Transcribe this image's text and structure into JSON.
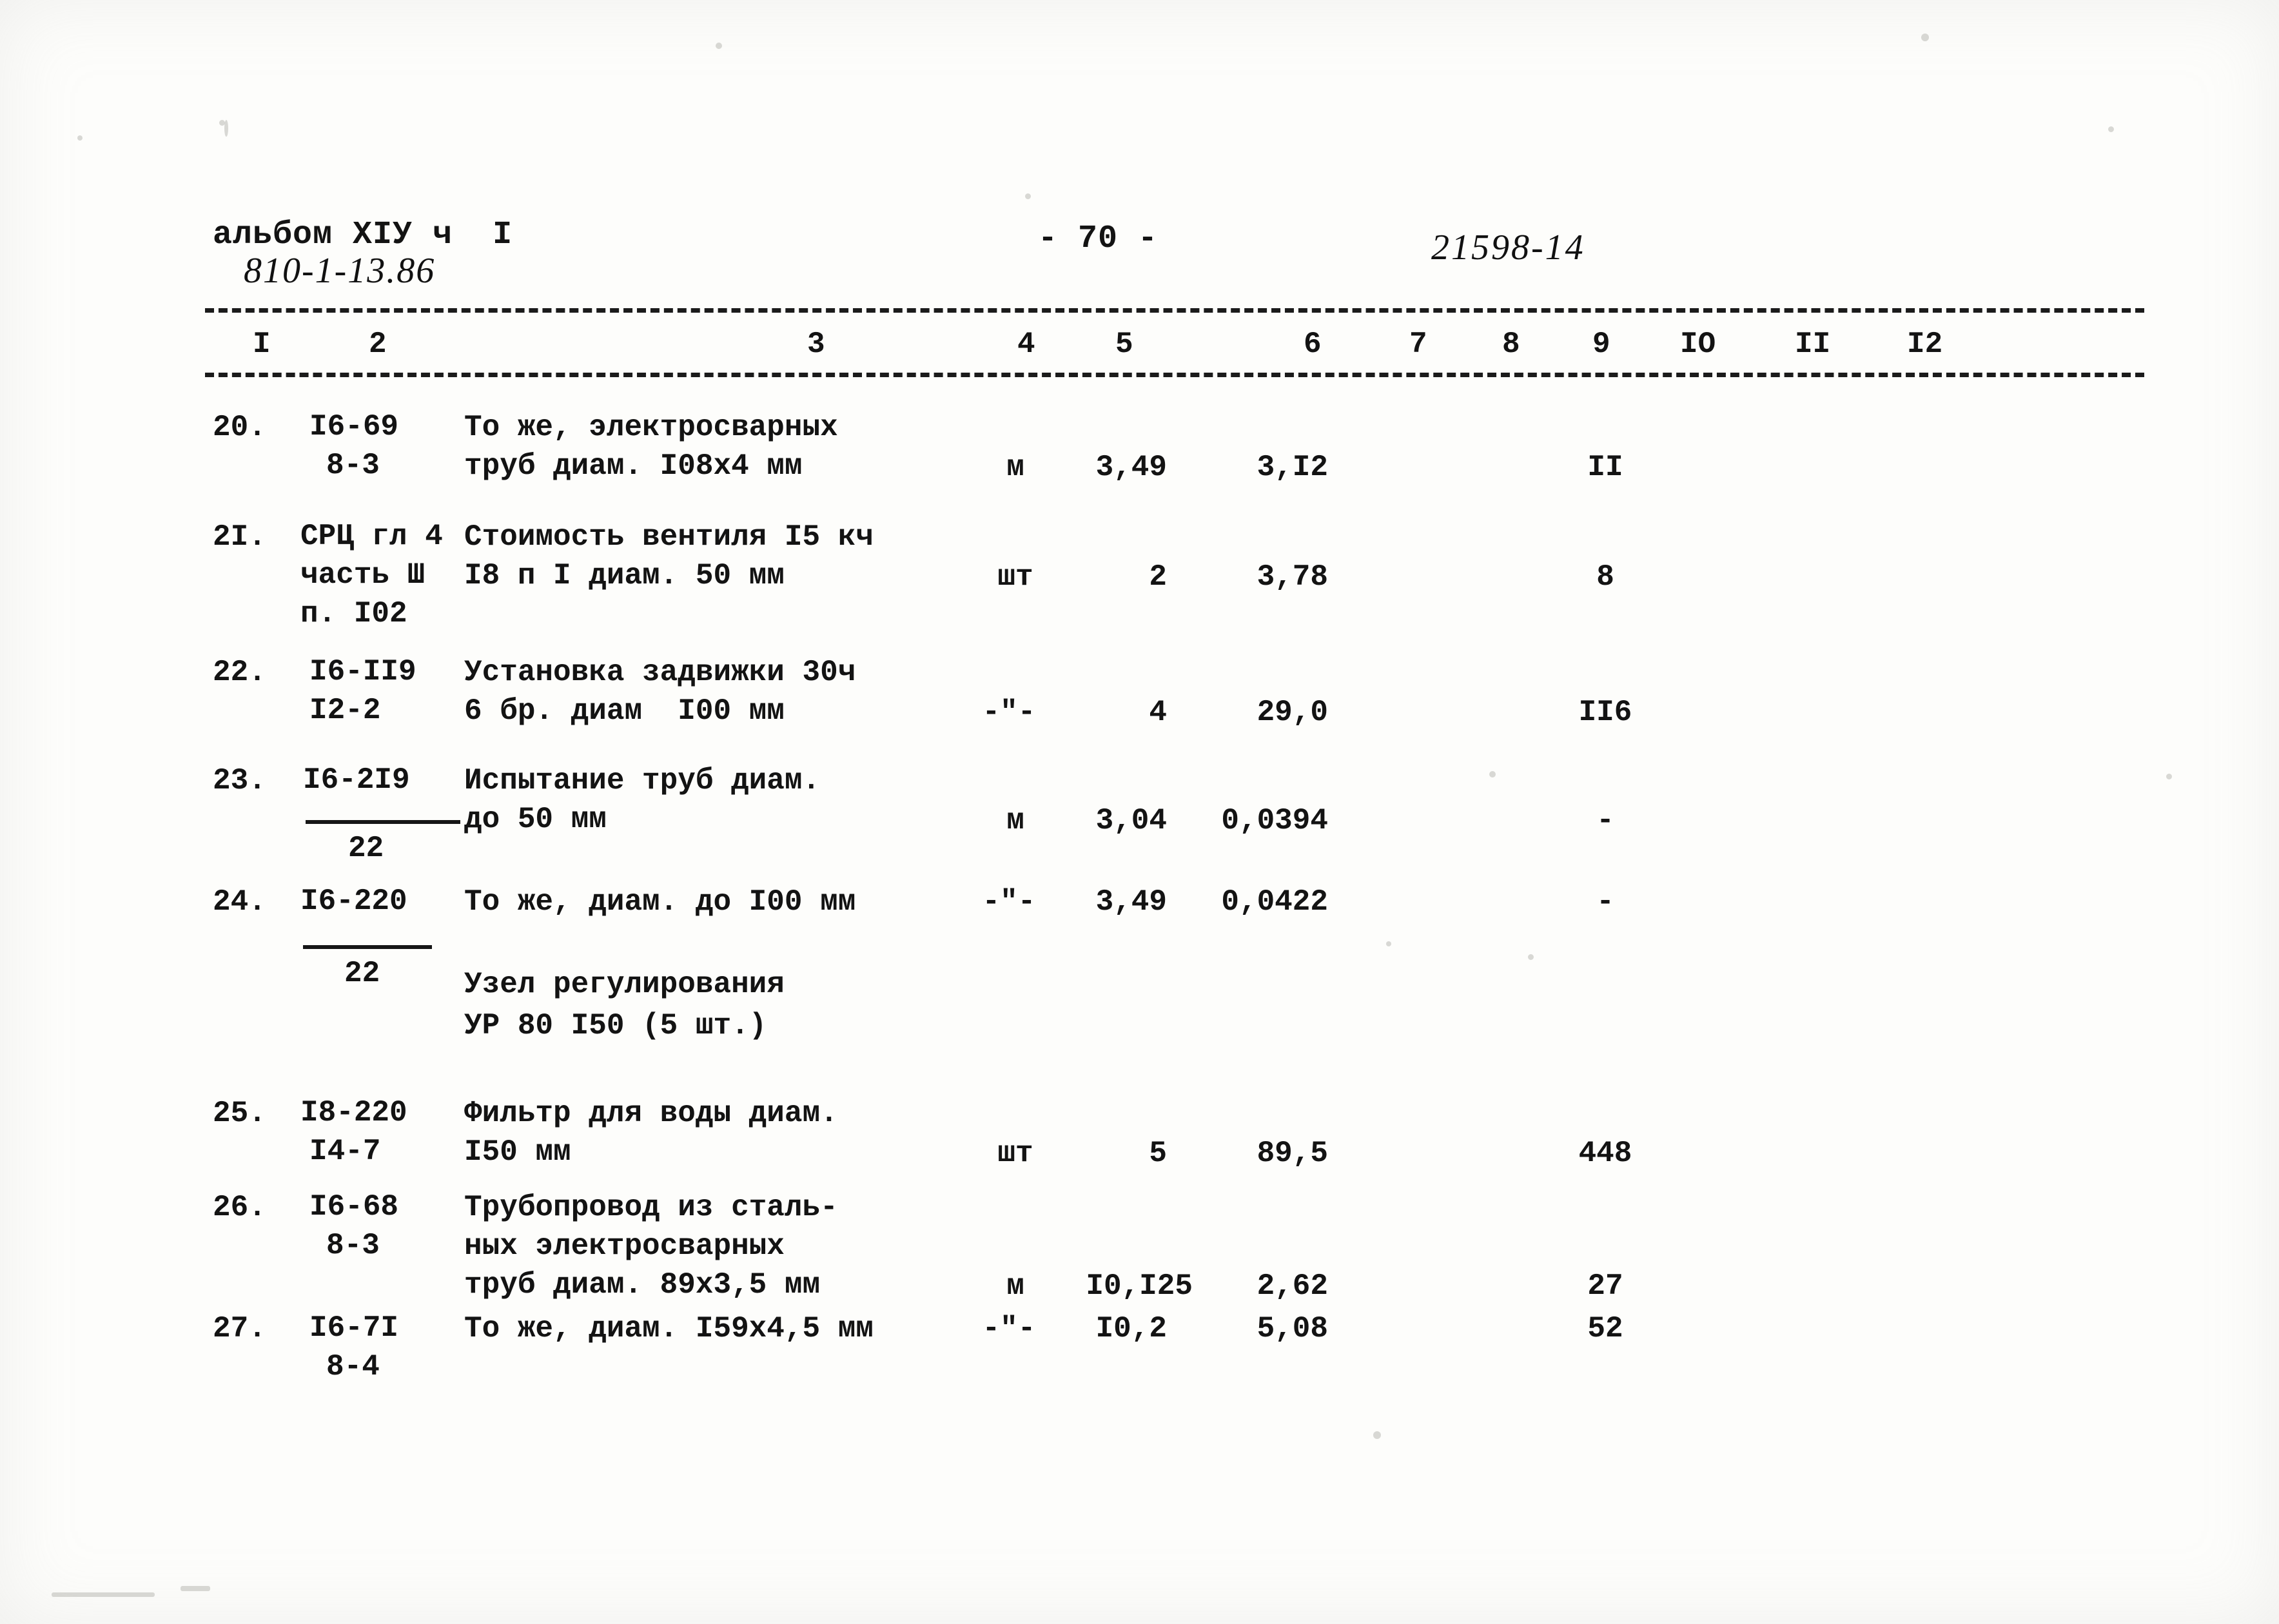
{
  "document": {
    "album_line": "альбом XIУ ч  I",
    "album_code_handwritten": "810-1-13.86",
    "page_number": "- 70 -",
    "doc_code_handwritten": "21598-14"
  },
  "table": {
    "column_numbers": [
      "I",
      "2",
      "3",
      "4",
      "5",
      "6",
      "7",
      "8",
      "9",
      "IO",
      "II",
      "I2"
    ],
    "rows": [
      {
        "no": "20.",
        "code_line1": "I6-69",
        "code_line2": "8-3",
        "desc_line1": "То же, электросварных",
        "desc_line2": "труб диам. I08х4 мм",
        "unit": "м",
        "qty": "3,49",
        "price": "3,I2",
        "total": "II"
      },
      {
        "no": "2I.",
        "code_line1": "СРЦ гл 4",
        "code_line2": "часть Ш",
        "code_line3": "п. I02",
        "desc_line1": "Стоимость вентиля I5 кч",
        "desc_line2": "I8 п I диам. 50 мм",
        "unit": "шт",
        "qty": "2",
        "price": "3,78",
        "total": "8"
      },
      {
        "no": "22.",
        "code_line1": "I6-II9",
        "code_line2": "I2-2",
        "desc_line1": "Установка задвижки 30ч",
        "desc_line2": "6 бр. диам  I00 мм",
        "unit": "-\"-",
        "qty": "4",
        "price": "29,0",
        "total": "II6"
      },
      {
        "no": "23.",
        "code_line1": "I6-2I9",
        "code_line2": "22",
        "code_fraction": true,
        "desc_line1": "Испытание труб диам.",
        "desc_line2": "до 50 мм",
        "unit": "м",
        "qty": "3,04",
        "price": "0,0394",
        "total": "-"
      },
      {
        "no": "24.",
        "code_line1": "I6-220",
        "code_line2": "22",
        "code_fraction": true,
        "desc_line1": "То же, диам. до I00 мм",
        "desc_line2": "",
        "unit": "-\"-",
        "qty": "3,49",
        "price": "0,0422",
        "total": "-"
      },
      {
        "no": "25.",
        "code_line1": "I8-220",
        "code_line2": "I4-7",
        "desc_line1": "Фильтр для воды диам.",
        "desc_line2": "I50 мм",
        "unit": "шт",
        "qty": "5",
        "price": "89,5",
        "total": "448"
      },
      {
        "no": "26.",
        "code_line1": "I6-68",
        "code_line2": "8-3",
        "desc_line1": "Трубопровод из сталь-",
        "desc_line2": "ных электросварных",
        "desc_line3": "труб диам. 89х3,5 мм",
        "unit": "м",
        "qty": "I0,I25",
        "price": "2,62",
        "total": "27"
      },
      {
        "no": "27.",
        "code_line1": "I6-7I",
        "code_line2": "8-4",
        "desc_line1": "То же, диам. I59х4,5 мм",
        "desc_line2": "",
        "unit": "-\"-",
        "qty": "I0,2",
        "price": "5,08",
        "total": "52"
      }
    ],
    "section_heading": {
      "line1": "Узел регулирования",
      "line2": "УР 80 I50 (5 шт.)"
    }
  }
}
